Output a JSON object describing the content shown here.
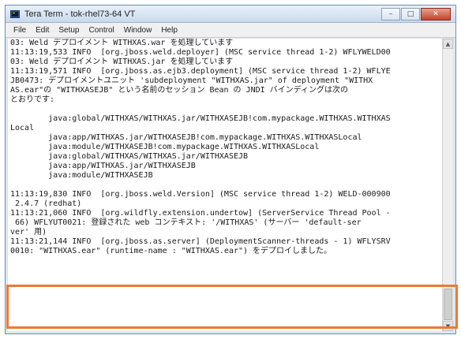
{
  "window": {
    "title": "Tera Term - tok-rhel73-64 VT",
    "controls": {
      "minimize": "–",
      "maximize": "□",
      "close": "✕"
    }
  },
  "menu": [
    "File",
    "Edit",
    "Setup",
    "Control",
    "Window",
    "Help"
  ],
  "terminal": {
    "lines": [
      "03: Weld デプロイメント WITHXAS.war を処理しています",
      "11:13:19,533 INFO  [org.jboss.weld.deployer] (MSC service thread 1-2) WFLYWELD00",
      "03: Weld デプロイメント WITHXAS.jar を処理しています",
      "11:13:19,571 INFO  [org.jboss.as.ejb3.deployment] (MSC service thread 1-2) WFLYE",
      "JB0473: デプロイメントユニット 'subdeployment \"WITHXAS.jar\" of deployment \"WITHX",
      "AS.ear\"の \"WITHXASEJB\" という名前のセッション Bean の JNDI バインディングは次の",
      "とおりです:",
      "",
      "        java:global/WITHXAS/WITHXAS.jar/WITHXASEJB!com.mypackage.WITHXAS.WITHXAS",
      "Local",
      "        java:app/WITHXAS.jar/WITHXASEJB!com.mypackage.WITHXAS.WITHXASLocal",
      "        java:module/WITHXASEJB!com.mypackage.WITHXAS.WITHXASLocal",
      "        java:global/WITHXAS/WITHXAS.jar/WITHXASEJB",
      "        java:app/WITHXAS.jar/WITHXASEJB",
      "        java:module/WITHXASEJB",
      "",
      "11:13:19,830 INFO  [org.jboss.weld.Version] (MSC service thread 1-2) WELD-000900",
      " 2.4.7 (redhat)",
      "11:13:21,060 INFO  [org.wildfly.extension.undertow] (ServerService Thread Pool -",
      " 66) WFLYUT0021: 登録された web コンテキスト: '/WITHXAS' (サーバー 'default-ser",
      "ver' 用)",
      "11:13:21,144 INFO  [org.jboss.as.server] (DeploymentScanner-threads - 1) WFLYSRV",
      "0010: \"WITHXAS.ear\" (runtime-name : \"WITHXAS.ear\") をデプロイしました。",
      "",
      "",
      "",
      ""
    ]
  },
  "colors": {
    "highlight": "#ee7a30"
  }
}
